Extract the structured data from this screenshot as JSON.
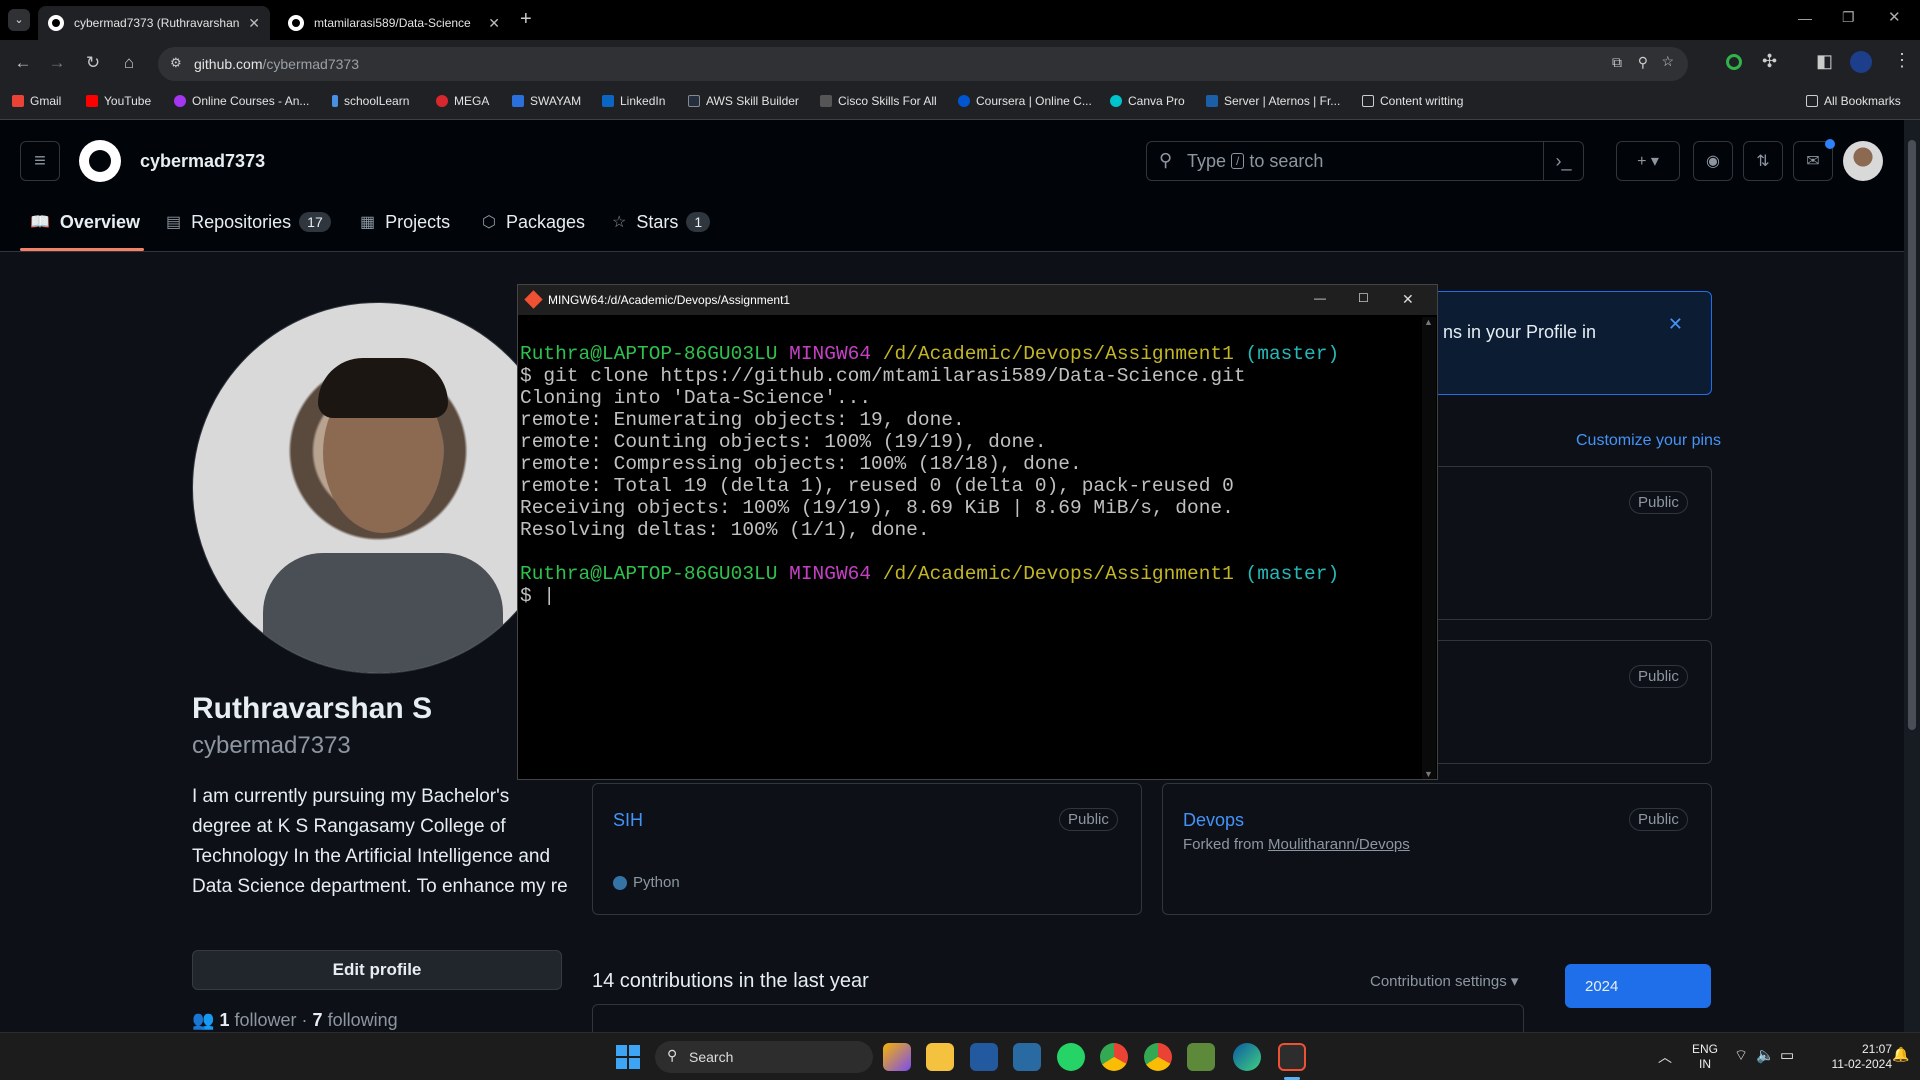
{
  "browser": {
    "tabs": [
      {
        "title": "cybermad7373 (Ruthravarshan",
        "active": true
      },
      {
        "title": "mtamilarasi589/Data-Science",
        "active": false
      }
    ],
    "url_host": "github.com",
    "url_path": "/cybermad7373",
    "bookmarks": [
      "Gmail",
      "YouTube",
      "Online Courses - An...",
      "schoolLearn",
      "MEGA",
      "SWAYAM",
      "LinkedIn",
      "AWS Skill Builder",
      "Cisco Skills For All",
      "Coursera | Online C...",
      "Canva Pro",
      "Server | Aternos | Fr...",
      "Content writting"
    ],
    "all_bookmarks": "All Bookmarks"
  },
  "github": {
    "username_header": "cybermad7373",
    "search_placeholder_pre": "Type",
    "search_key": "/",
    "search_placeholder_post": "to search",
    "tabs": [
      {
        "label": "Overview",
        "icon": "book-icon",
        "count": ""
      },
      {
        "label": "Repositories",
        "icon": "repo-icon",
        "count": "17"
      },
      {
        "label": "Projects",
        "icon": "table-icon",
        "count": ""
      },
      {
        "label": "Packages",
        "icon": "package-icon",
        "count": ""
      },
      {
        "label": "Stars",
        "icon": "star-icon",
        "count": "1"
      }
    ],
    "profile": {
      "name": "Ruthravarshan S",
      "login": "cybermad7373",
      "bio": "I am currently pursuing my Bachelor's degree at K S Rangasamy College of Technology In the Artificial Intelligence and Data Science department. To enhance my re",
      "edit_profile": "Edit profile",
      "followers_count": "1",
      "followers_label": "follower",
      "following_count": "7",
      "following_label": "following"
    },
    "banner_text": "ns in your Profile in",
    "customize_pins": "Customize your pins",
    "public_label": "Public",
    "repos": [
      {
        "name": "SIH",
        "language": "Python",
        "forked_from": ""
      },
      {
        "name": "Devops",
        "language": "",
        "forked_prefix": "Forked from ",
        "forked_from": "Moulitharann/Devops"
      }
    ],
    "contributions_title": "14 contributions in the last year",
    "contribution_settings": "Contribution settings",
    "year": "2024"
  },
  "terminal": {
    "title": "MINGW64:/d/Academic/Devops/Assignment1",
    "prompt_user": "Ruthra@LAPTOP-86GU03LU",
    "prompt_env": "MINGW64",
    "prompt_path": "/d/Academic/Devops/Assignment1",
    "prompt_branch": "(master)",
    "command": "$ git clone https://github.com/mtamilarasi589/Data-Science.git",
    "output": [
      "Cloning into 'Data-Science'...",
      "remote: Enumerating objects: 19, done.",
      "remote: Counting objects: 100% (19/19), done.",
      "remote: Compressing objects: 100% (18/18), done.",
      "remote: Total 19 (delta 1), reused 0 (delta 0), pack-reused 0",
      "Receiving objects: 100% (19/19), 8.69 KiB | 8.69 MiB/s, done.",
      "Resolving deltas: 100% (1/1), done."
    ],
    "cursor_line": "$ |"
  },
  "taskbar": {
    "search": "Search",
    "lang_top": "ENG",
    "lang_bottom": "IN",
    "time": "21:07",
    "date": "11-02-2024"
  }
}
